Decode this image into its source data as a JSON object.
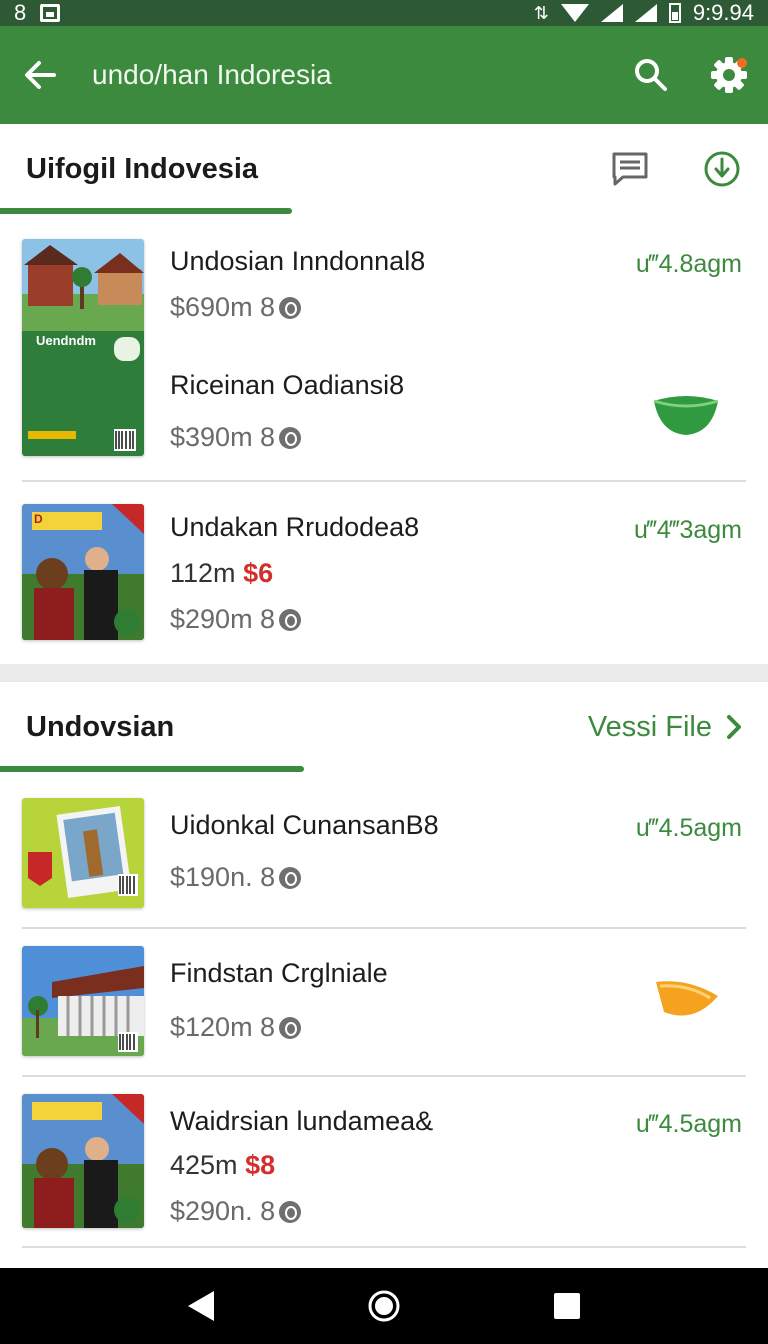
{
  "status_bar": {
    "left_text": "8",
    "time": "9:9.94"
  },
  "app_bar": {
    "title": "undo/han Indoresia"
  },
  "section1": {
    "title": "Uifogil Indovesia"
  },
  "section2": {
    "title": "Undovsian",
    "link_label": "Vessi File"
  },
  "items1": [
    {
      "name": "Undosian Inndonnal8",
      "price": "$690m 8",
      "weight": "u‴4.8agm"
    },
    {
      "name": "Riceinan Oadiansi8",
      "price": "$390m 8"
    },
    {
      "name": "Undakan Rrudodea8",
      "qty": "112m",
      "qty_red": "$6",
      "price": "$290m 8",
      "weight": "u‴4‴3agm"
    }
  ],
  "items2": [
    {
      "name": "Uidonkal CunansanB8",
      "price": "$190n. 8",
      "weight": "u‴4.5agm"
    },
    {
      "name": "Findstan Crglniale",
      "price": "$120m 8"
    },
    {
      "name": "Waidrsian lundamea&",
      "qty": "425m",
      "qty_red": "$8",
      "price": "$290n. 8",
      "weight": "u‴4.5agm"
    }
  ],
  "thumb_labels": {
    "book": "Uendndm",
    "banner": "D"
  },
  "colors": {
    "brand_green": "#3b8a3e",
    "status_green": "#2d5a34",
    "price_red": "#d32f2f"
  },
  "icons": [
    "back-arrow-icon",
    "search-icon",
    "settings-icon",
    "chat-icon",
    "download-icon",
    "chevron-right-icon",
    "coin-icon",
    "bowl-icon",
    "orange-slice-icon"
  ]
}
